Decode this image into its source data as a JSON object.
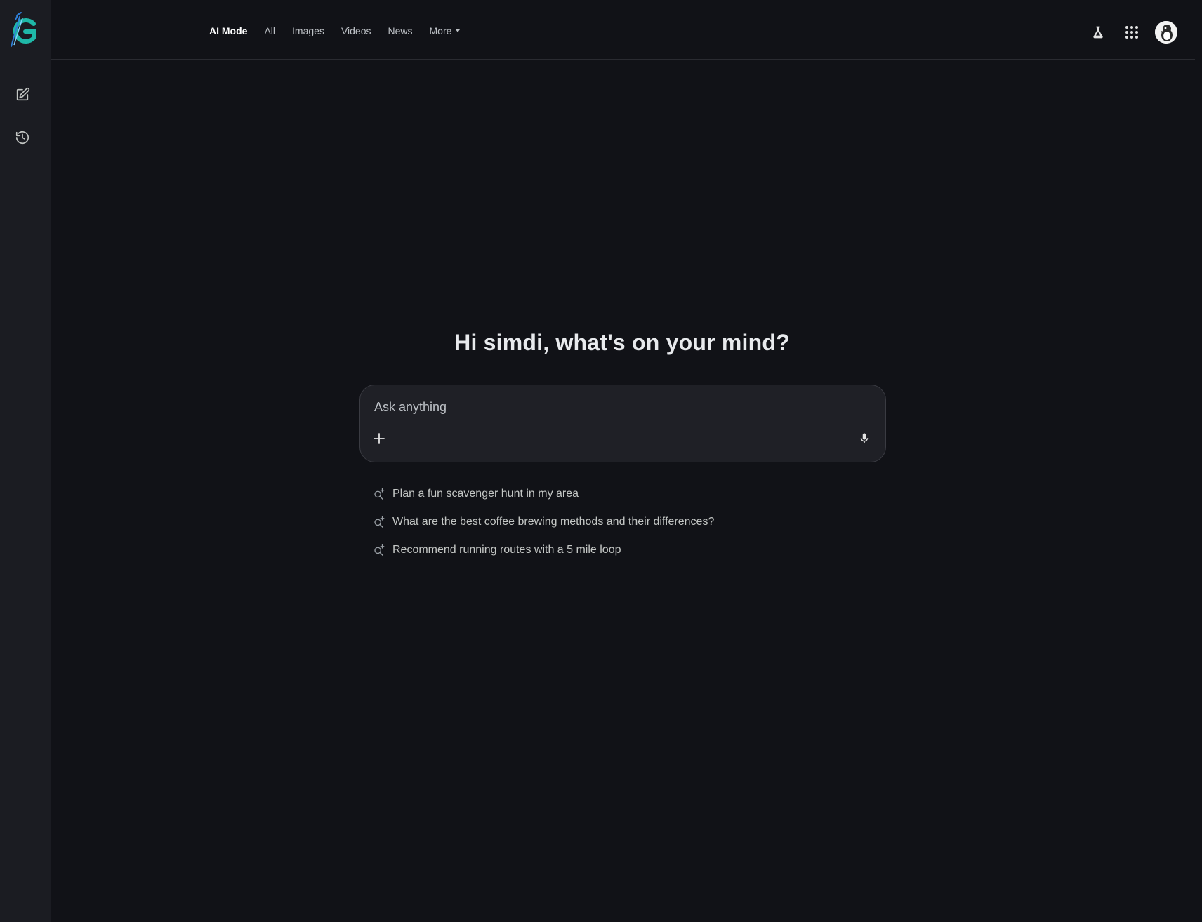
{
  "header": {
    "tabs": [
      {
        "label": "AI Mode",
        "active": true
      },
      {
        "label": "All"
      },
      {
        "label": "Images"
      },
      {
        "label": "Videos"
      },
      {
        "label": "News"
      },
      {
        "label": "More"
      }
    ],
    "icons": [
      "labs-flask-icon",
      "apps-grid-icon",
      "account-avatar"
    ]
  },
  "sidebar": {
    "icons": [
      "logo",
      "new-chat-icon",
      "history-icon"
    ]
  },
  "main": {
    "greeting": "Hi simdi, what's on your mind?",
    "search": {
      "placeholder": "Ask anything",
      "value": ""
    },
    "suggestions": [
      "Plan a fun scavenger hunt in my area",
      "What are the best coffee brewing methods and their differences?",
      "Recommend running routes with a 5 mile loop"
    ]
  },
  "colors": {
    "background": "#111217",
    "sidebar": "#1b1c22",
    "prompt_box": "#1f2026",
    "logo_primary": "#1fb8a8",
    "logo_accent": "#2f7fd8"
  }
}
